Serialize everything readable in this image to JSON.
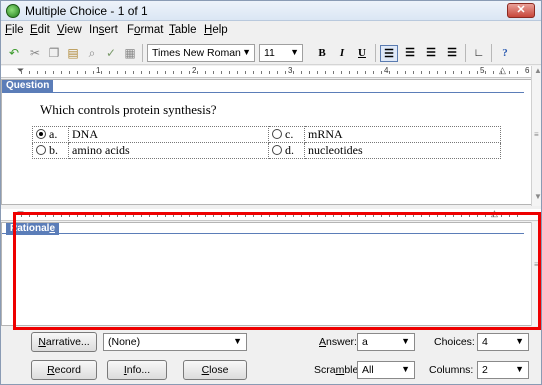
{
  "window": {
    "title": "Multiple Choice - 1 of 1",
    "close_glyph": "✕"
  },
  "menu": [
    {
      "pre": "",
      "u": "F",
      "post": "ile"
    },
    {
      "pre": "",
      "u": "E",
      "post": "dit"
    },
    {
      "pre": "",
      "u": "V",
      "post": "iew"
    },
    {
      "pre": "In",
      "u": "s",
      "post": "ert"
    },
    {
      "pre": "F",
      "u": "o",
      "post": "rmat"
    },
    {
      "pre": "",
      "u": "T",
      "post": "able"
    },
    {
      "pre": "",
      "u": "H",
      "post": "elp"
    }
  ],
  "toolbar": {
    "font_name": "Times New Roman",
    "font_size": "11",
    "bold": "B",
    "italic": "I",
    "underline": "U",
    "help": "?"
  },
  "ruler": {
    "numbers": [
      "1",
      "2",
      "3",
      "4",
      "5",
      "6"
    ]
  },
  "question": {
    "label": "Question",
    "text": "Which controls protein synthesis?",
    "choices": [
      {
        "letter": "a.",
        "text": "DNA",
        "selected": true
      },
      {
        "letter": "b.",
        "text": "amino acids",
        "selected": false
      },
      {
        "letter": "c.",
        "text": "mRNA",
        "selected": false
      },
      {
        "letter": "d.",
        "text": "nucleotides",
        "selected": false
      }
    ]
  },
  "rationale": {
    "label_pre": "Rational",
    "label_u": "e",
    "label_post": "",
    "text": ""
  },
  "bottom": {
    "narrative_u": "N",
    "narrative_rest": "arrative...",
    "narrative_value": "(None)",
    "answer_label_u": "A",
    "answer_label_rest": "nswer:",
    "answer_value": "a",
    "choices_label": "Choices:",
    "choices_value": "4",
    "record_u": "R",
    "record_rest": "ecord",
    "info_u": "I",
    "info_rest": "nfo...",
    "close_u": "C",
    "close_rest": "lose",
    "scramble_pre": "Scra",
    "scramble_u": "m",
    "scramble_post": "ble:",
    "scramble_value": "All",
    "columns_label": "Columns:",
    "columns_value": "2"
  },
  "colors": {
    "section_label": "#5b7db8",
    "highlight": "#ee0000"
  }
}
